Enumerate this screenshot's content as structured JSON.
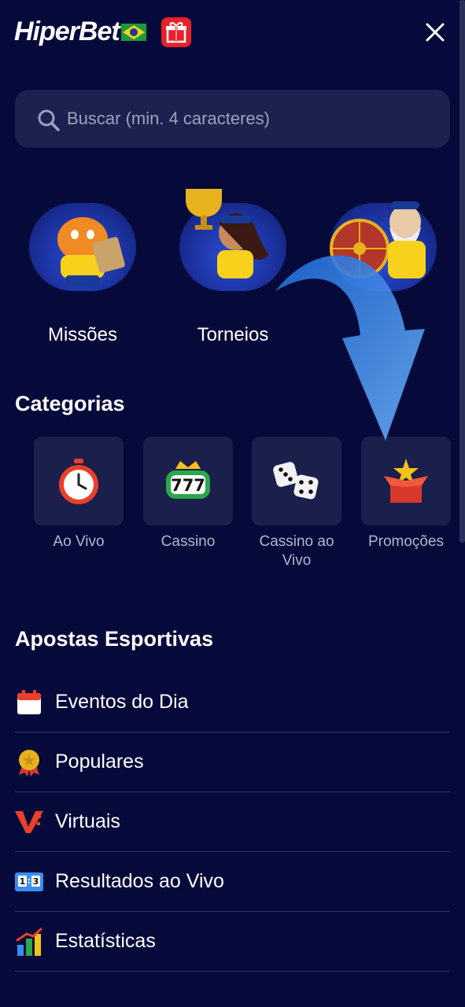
{
  "header": {
    "logo_text": "HiperBet",
    "logo_flag_icon": "brazil-flag-icon",
    "gift_icon": "gift-icon",
    "close_icon": "close-icon"
  },
  "search": {
    "placeholder": "Buscar (min. 4 caracteres)",
    "value": "",
    "icon": "search-icon"
  },
  "features": [
    {
      "label": "Missões",
      "icon": "tiger-mascot-icon"
    },
    {
      "label": "Torneios",
      "icon": "trophy-mascot-icon"
    },
    {
      "label": "",
      "icon": "wheel-mascot-icon"
    }
  ],
  "categories": {
    "title": "Categorias",
    "items": [
      {
        "label": "Ao Vivo",
        "icon": "stopwatch-icon"
      },
      {
        "label": "Cassino",
        "icon": "slot-777-icon"
      },
      {
        "label": "Cassino ao Vivo",
        "icon": "dice-icon"
      },
      {
        "label": "Promoções",
        "icon": "gift-box-star-icon"
      }
    ]
  },
  "sports": {
    "title": "Apostas Esportivas",
    "items": [
      {
        "label": "Eventos do Dia",
        "icon": "calendar-icon"
      },
      {
        "label": "Populares",
        "icon": "medal-icon"
      },
      {
        "label": "Virtuais",
        "icon": "virtual-v-icon"
      },
      {
        "label": "Resultados ao Vivo",
        "icon": "scoreboard-icon"
      },
      {
        "label": "Estatísticas",
        "icon": "bar-chart-icon"
      }
    ]
  },
  "colors": {
    "background": "#060a3a",
    "tile": "#1b1f4c",
    "search_bg": "#1d2150",
    "accent_red": "#e8202a",
    "arrow_blue": "#3a8ef0"
  }
}
